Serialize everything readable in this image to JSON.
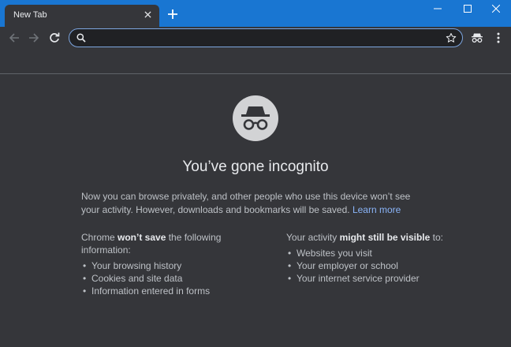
{
  "tab": {
    "title": "New Tab"
  },
  "omnibox": {
    "value": "",
    "placeholder": ""
  },
  "page": {
    "heading": "You’ve gone incognito",
    "intro": "Now you can browse privately, and other people who use this device won’t see your activity. However, downloads and bookmarks will be saved.",
    "learn_more": "Learn more"
  },
  "wont_save": {
    "prefix": "Chrome ",
    "bold": "won’t save",
    "suffix": " the following information:",
    "items": [
      "Your browsing history",
      "Cookies and site data",
      "Information entered in forms"
    ]
  },
  "might_visible": {
    "prefix": "Your activity ",
    "bold": "might still be visible",
    "suffix": " to:",
    "items": [
      "Websites you visit",
      "Your employer or school",
      "Your internet service provider"
    ]
  },
  "colors": {
    "titlebar": "#1976d2",
    "background": "#35363a",
    "link": "#8ab4f8"
  },
  "icons": [
    "close-icon",
    "plus-icon",
    "minimize-icon",
    "maximize-icon",
    "window-close-icon",
    "back-arrow-icon",
    "forward-arrow-icon",
    "reload-icon",
    "search-icon",
    "star-icon",
    "incognito-icon",
    "more-vert-icon"
  ]
}
